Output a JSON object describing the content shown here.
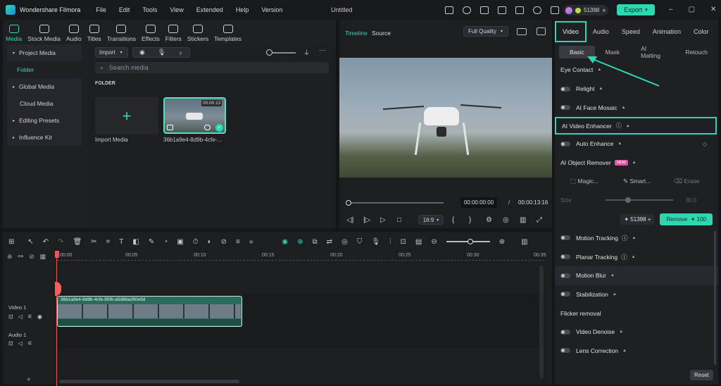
{
  "app": {
    "name": "Wondershare Filmora",
    "title": "Untitled",
    "credits": "51398",
    "export_label": "Export",
    "menu": [
      "File",
      "Edit",
      "Tools",
      "View",
      "Extended",
      "Help",
      "Version"
    ]
  },
  "top_tabs": [
    "Media",
    "Stock Media",
    "Audio",
    "Titles",
    "Transitions",
    "Effects",
    "Filters",
    "Stickers",
    "Templates"
  ],
  "sidebar": {
    "items": [
      "Project Media",
      "Folder",
      "Global Media",
      "Cloud Media",
      "Editing Presets",
      "Influence Kit"
    ]
  },
  "media": {
    "import_label": "Import",
    "search_placeholder": "Search media",
    "folder_label": "FOLDER",
    "import_media_label": "Import Media",
    "clip_name": "36b1a9e4-8d9b-4cfe-...",
    "clip_duration": "00:00:13"
  },
  "viewer": {
    "tab_timeline": "Timeline",
    "tab_source": "Source",
    "quality": "Full Quality",
    "current_time": "00:00:00:00",
    "sep": "/",
    "total_time": "00:00:13:16",
    "aspect": "16:9"
  },
  "right_panel": {
    "tabs": [
      "Video",
      "Audio",
      "Speed",
      "Animation",
      "Color"
    ],
    "subtabs": [
      "Basic",
      "Mask",
      "AI Matting",
      "Retouch"
    ],
    "rows": {
      "eye_contact": "Eye Contact",
      "relight": "Relight",
      "face_mosaic": "AI Face Mosaic",
      "video_enhancer": "AI Video Enhancer",
      "auto_enhance": "Auto Enhance",
      "object_remover": "AI Object Remover",
      "new_badge": "NEW",
      "magic": "Magic...",
      "smart": "Smart...",
      "erase": "Erase",
      "size_label": "Size",
      "size_value": "30.0",
      "credits": "51398",
      "remove_label": "Remove",
      "remove_cost": "100",
      "motion_tracking": "Motion Tracking",
      "planar_tracking": "Planar Tracking",
      "motion_blur": "Motion Blur",
      "stabilization": "Stabilization",
      "flicker_removal": "Flicker removal",
      "video_denoise": "Video Denoise",
      "lens_correction": "Lens Correction",
      "reset": "Reset"
    }
  },
  "timeline": {
    "ruler": [
      "00:00",
      "00:05",
      "00:10",
      "00:15",
      "00:20",
      "00:25",
      "00:30",
      "00:35"
    ],
    "video_track": "Video 1",
    "audio_track": "Audio 1",
    "clip_label": "36b1a9e4-8d9b-4cfe-95f6-a5d88a260e9d"
  },
  "colors": {
    "accent": "#2fd7b0",
    "export_bg": "#2fd7b0",
    "highlight_border": "#2fd7b0"
  }
}
